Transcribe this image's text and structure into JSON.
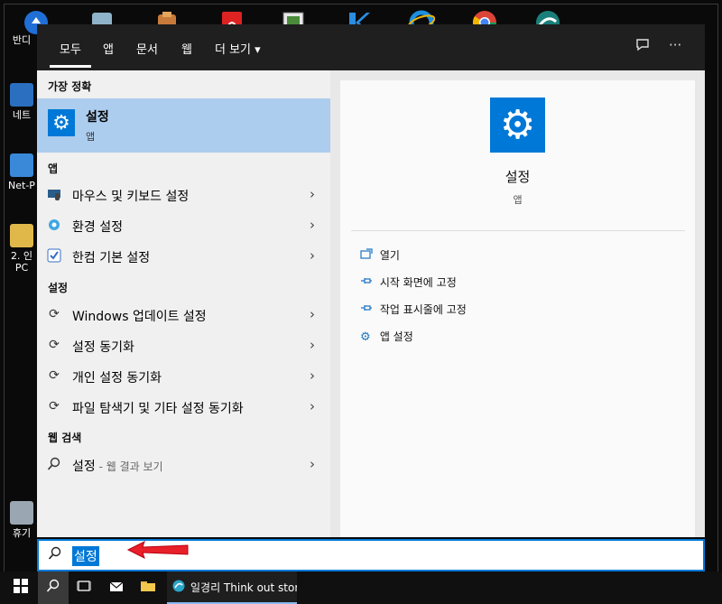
{
  "tabs": [
    {
      "label": "모두"
    },
    {
      "label": "앱"
    },
    {
      "label": "문서"
    },
    {
      "label": "웹"
    },
    {
      "label": "더 보기 ▾"
    }
  ],
  "top_right": {
    "feedback_icon": "feedback-icon",
    "more_label": "···"
  },
  "best_match": {
    "header": "가장 정확",
    "title": "설정",
    "subtitle": "앱"
  },
  "apps": {
    "header": "앱",
    "items": [
      {
        "label": "마우스 및 키보드 설정",
        "icon": "mouse-keyboard-icon"
      },
      {
        "label": "환경 설정",
        "icon": "preferences-icon"
      },
      {
        "label": "한컴 기본 설정",
        "icon": "hancom-settings-icon"
      }
    ]
  },
  "settings": {
    "header": "설정",
    "items": [
      {
        "label": "Windows 업데이트 설정",
        "icon": "sync-icon"
      },
      {
        "label": "설정 동기화",
        "icon": "sync-icon"
      },
      {
        "label": "개인 설정 동기화",
        "icon": "sync-icon"
      },
      {
        "label": "파일 탐색기 및 기타 설정 동기화",
        "icon": "sync-icon"
      }
    ]
  },
  "web": {
    "header": "웹 검색",
    "items": [
      {
        "label": "설정",
        "hint": " - 웹 결과 보기",
        "icon": "search-icon"
      }
    ]
  },
  "detail": {
    "title": "설정",
    "subtitle": "앱",
    "actions": [
      {
        "label": "열기",
        "icon": "open-icon"
      },
      {
        "label": "시작 화면에 고정",
        "icon": "pin-icon"
      },
      {
        "label": "작업 표시줄에 고정",
        "icon": "pin-icon"
      },
      {
        "label": "앱 설정",
        "icon": "gear-icon"
      }
    ]
  },
  "search": {
    "value": "설정"
  },
  "desktop_icons": [
    {
      "label": "반디"
    },
    {
      "label": "네트"
    },
    {
      "label": "Net-P"
    },
    {
      "label": "2. 인\nPC"
    },
    {
      "label": "휴기"
    }
  ],
  "taskbar": {
    "app_label": "일경리 Think out stor..."
  },
  "colors": {
    "accent": "#0078d7",
    "selection": "#adcdee",
    "topbar": "#1f1f1f"
  }
}
